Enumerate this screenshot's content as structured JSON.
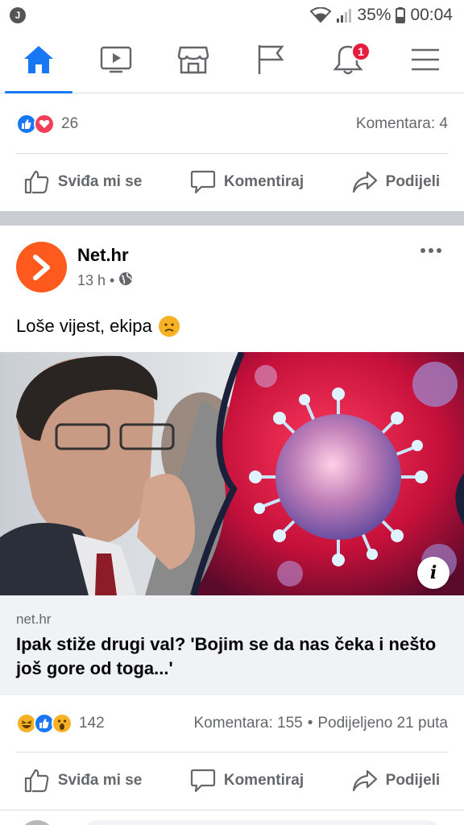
{
  "status_bar": {
    "app_badge": "J",
    "battery": "35%",
    "time": "00:04",
    "icons": [
      "wifi-icon",
      "signal-icon",
      "battery-icon"
    ]
  },
  "nav": {
    "tabs": [
      {
        "name": "home",
        "icon": "home-icon",
        "active": true
      },
      {
        "name": "watch",
        "icon": "video-icon",
        "active": false
      },
      {
        "name": "marketplace",
        "icon": "store-icon",
        "active": false
      },
      {
        "name": "pages",
        "icon": "flag-icon",
        "active": false
      },
      {
        "name": "notifications",
        "icon": "bell-icon",
        "active": false,
        "badge": "1"
      },
      {
        "name": "menu",
        "icon": "hamburger-icon",
        "active": false
      }
    ],
    "accent": "#1877f2",
    "badge_color": "#e41e3f"
  },
  "prev_post": {
    "reaction_count": "26",
    "comments": "Komentara: 4",
    "actions": {
      "like": "Sviđa mi se",
      "comment": "Komentiraj",
      "share": "Podijeli"
    }
  },
  "post": {
    "author": "Net.hr",
    "time": "13 h",
    "separator": "•",
    "text": "Loše vijest, ekipa",
    "link": {
      "domain": "net.hr",
      "title": "Ipak stiže drugi val? 'Bojim se da nas čeka i nešto još gore od toga...'"
    },
    "reaction_count": "142",
    "comments": "Komentara: 155",
    "stats_separator": "•",
    "shares": "Podijeljeno 21 puta",
    "actions": {
      "like": "Sviđa mi se",
      "comment": "Komentiraj",
      "share": "Podijeli"
    }
  }
}
